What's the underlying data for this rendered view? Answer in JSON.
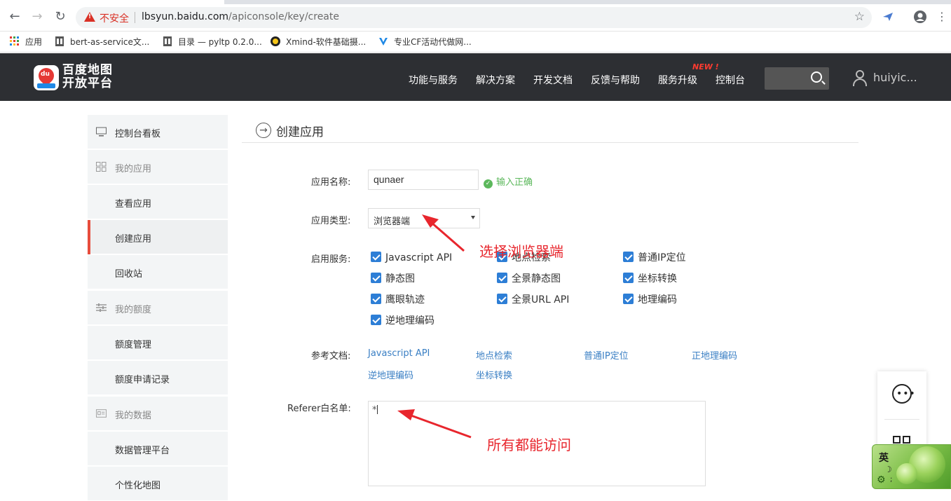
{
  "browser": {
    "url_warning": "不安全",
    "url_host": "lbsyun.baidu.com",
    "url_path": "/apiconsole/key/create",
    "bookmarks": [
      {
        "label": "应用"
      },
      {
        "label": "bert-as-service文..."
      },
      {
        "label": "目录 — pyltp 0.2.0..."
      },
      {
        "label": "Xmind-软件基础摄..."
      },
      {
        "label": "专业CF活动代做网..."
      }
    ]
  },
  "header": {
    "logo_line1": "百度地图",
    "logo_line2": "开放平台",
    "logo_badge": "du",
    "nav": [
      "功能与服务",
      "解决方案",
      "开发文档",
      "反馈与帮助",
      "服务升级",
      "控制台"
    ],
    "new_badge": "NEW !",
    "username": "huiyic..."
  },
  "sidebar": {
    "items": [
      {
        "label": "控制台看板"
      },
      {
        "label": "我的应用"
      },
      {
        "label": "查看应用"
      },
      {
        "label": "创建应用"
      },
      {
        "label": "回收站"
      },
      {
        "label": "我的额度"
      },
      {
        "label": "额度管理"
      },
      {
        "label": "额度申请记录"
      },
      {
        "label": "我的数据"
      },
      {
        "label": "数据管理平台"
      },
      {
        "label": "个性化地图"
      }
    ],
    "active_item": "创建应用"
  },
  "main": {
    "title": "创建应用",
    "app_name_label": "应用名称:",
    "app_name_value": "qunaer",
    "app_name_status": "输入正确",
    "app_type_label": "应用类型:",
    "app_type_value": "浏览器端",
    "services_label": "启用服务:",
    "services": [
      {
        "label": "Javascript API",
        "checked": true
      },
      {
        "label": "地点检索",
        "checked": true
      },
      {
        "label": "普通IP定位",
        "checked": true
      },
      {
        "label": "静态图",
        "checked": true
      },
      {
        "label": "全景静态图",
        "checked": true
      },
      {
        "label": "坐标转换",
        "checked": true
      },
      {
        "label": "鹰眼轨迹",
        "checked": true
      },
      {
        "label": "全景URL API",
        "checked": true
      },
      {
        "label": "地理编码",
        "checked": true
      },
      {
        "label": "逆地理编码",
        "checked": true
      }
    ],
    "docs_label": "参考文档:",
    "docs": [
      "Javascript API",
      "地点检索",
      "普通IP定位",
      "正地理编码",
      "逆地理编码",
      "坐标转换"
    ],
    "referer_label": "Referer白名单:",
    "referer_value": "*"
  },
  "annotations": {
    "select_browser": "选择浏览器端",
    "all_access": "所有都能访问",
    "color": "#e8262d"
  },
  "ime": {
    "lang": "英",
    "moon": "☽",
    "gear": "⚙",
    "semi": ";"
  }
}
